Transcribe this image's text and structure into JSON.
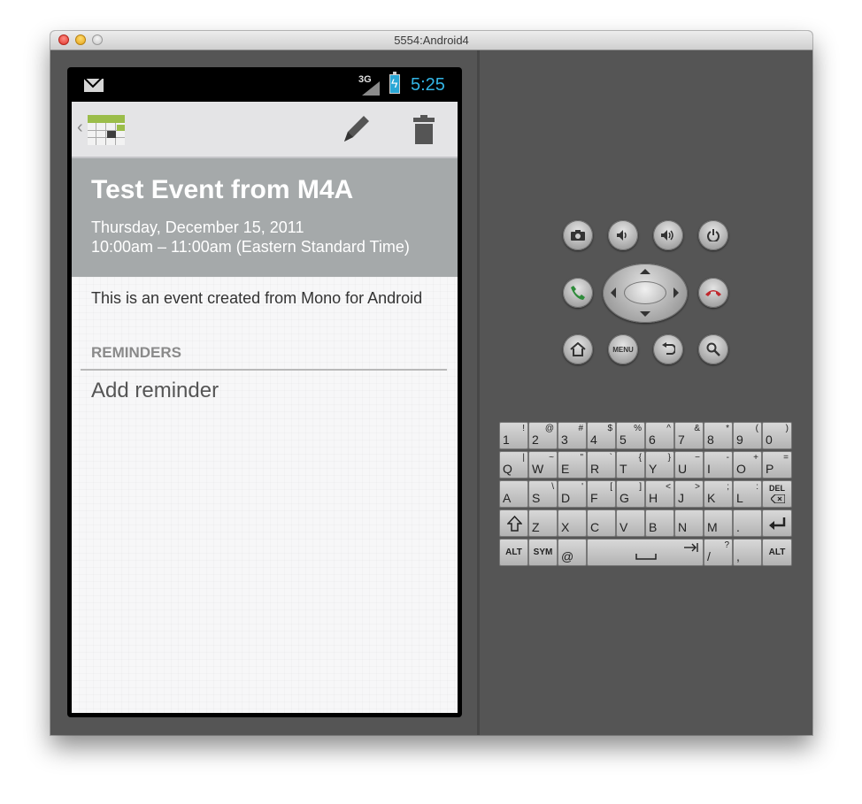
{
  "window": {
    "title": "5554:Android4"
  },
  "status_bar": {
    "network_label": "3G",
    "time": "5:25",
    "icons": [
      "mail-icon",
      "signal-3g-icon",
      "battery-charging-icon"
    ]
  },
  "action_bar": {
    "app_icon": "calendar-app-icon",
    "actions": [
      "edit-pencil-icon",
      "delete-trash-icon"
    ]
  },
  "event": {
    "title": "Test Event from M4A",
    "date": "Thursday, December 15, 2011",
    "time": "10:00am – 11:00am (Eastern Standard Time)",
    "description": "This is an event created from Mono for Android",
    "reminders_label": "REMINDERS",
    "add_reminder": "Add reminder"
  },
  "emulator_controls": {
    "menu_label": "MENU",
    "buttons": [
      "camera-icon",
      "volume-down-icon",
      "volume-up-icon",
      "power-icon",
      "call-icon",
      "end-call-icon",
      "home-icon",
      "menu-button",
      "back-icon",
      "search-icon"
    ]
  },
  "keyboard": {
    "row1": [
      {
        "main": "1",
        "sup": "!"
      },
      {
        "main": "2",
        "sup": "@"
      },
      {
        "main": "3",
        "sup": "#"
      },
      {
        "main": "4",
        "sup": "$"
      },
      {
        "main": "5",
        "sup": "%"
      },
      {
        "main": "6",
        "sup": "^"
      },
      {
        "main": "7",
        "sup": "&"
      },
      {
        "main": "8",
        "sup": "*"
      },
      {
        "main": "9",
        "sup": "("
      },
      {
        "main": "0",
        "sup": ")"
      }
    ],
    "row2": [
      {
        "main": "Q",
        "sup": "|"
      },
      {
        "main": "W",
        "sup": "~"
      },
      {
        "main": "E",
        "sup": "\""
      },
      {
        "main": "R",
        "sup": "`"
      },
      {
        "main": "T",
        "sup": "{"
      },
      {
        "main": "Y",
        "sup": "}"
      },
      {
        "main": "U",
        "sup": "−"
      },
      {
        "main": "I",
        "sup": "-"
      },
      {
        "main": "O",
        "sup": "+"
      },
      {
        "main": "P",
        "sup": "="
      }
    ],
    "row3": [
      {
        "main": "A",
        "sup": ""
      },
      {
        "main": "S",
        "sup": "\\"
      },
      {
        "main": "D",
        "sup": "'"
      },
      {
        "main": "F",
        "sup": "["
      },
      {
        "main": "G",
        "sup": "]"
      },
      {
        "main": "H",
        "sup": "<"
      },
      {
        "main": "J",
        "sup": ">"
      },
      {
        "main": "K",
        "sup": ";"
      },
      {
        "main": "L",
        "sup": ":"
      }
    ],
    "del_label": "DEL",
    "row4": [
      {
        "main": "Z",
        "sup": ""
      },
      {
        "main": "X",
        "sup": ""
      },
      {
        "main": "C",
        "sup": ""
      },
      {
        "main": "V",
        "sup": ""
      },
      {
        "main": "B",
        "sup": ""
      },
      {
        "main": "N",
        "sup": ""
      },
      {
        "main": "M",
        "sup": ""
      },
      {
        "main": ".",
        "sup": ""
      }
    ],
    "alt_label": "ALT",
    "sym_label": "SYM",
    "at_label": "@",
    "slash": {
      "main": "/",
      "sup": "?"
    },
    "comma": ","
  }
}
